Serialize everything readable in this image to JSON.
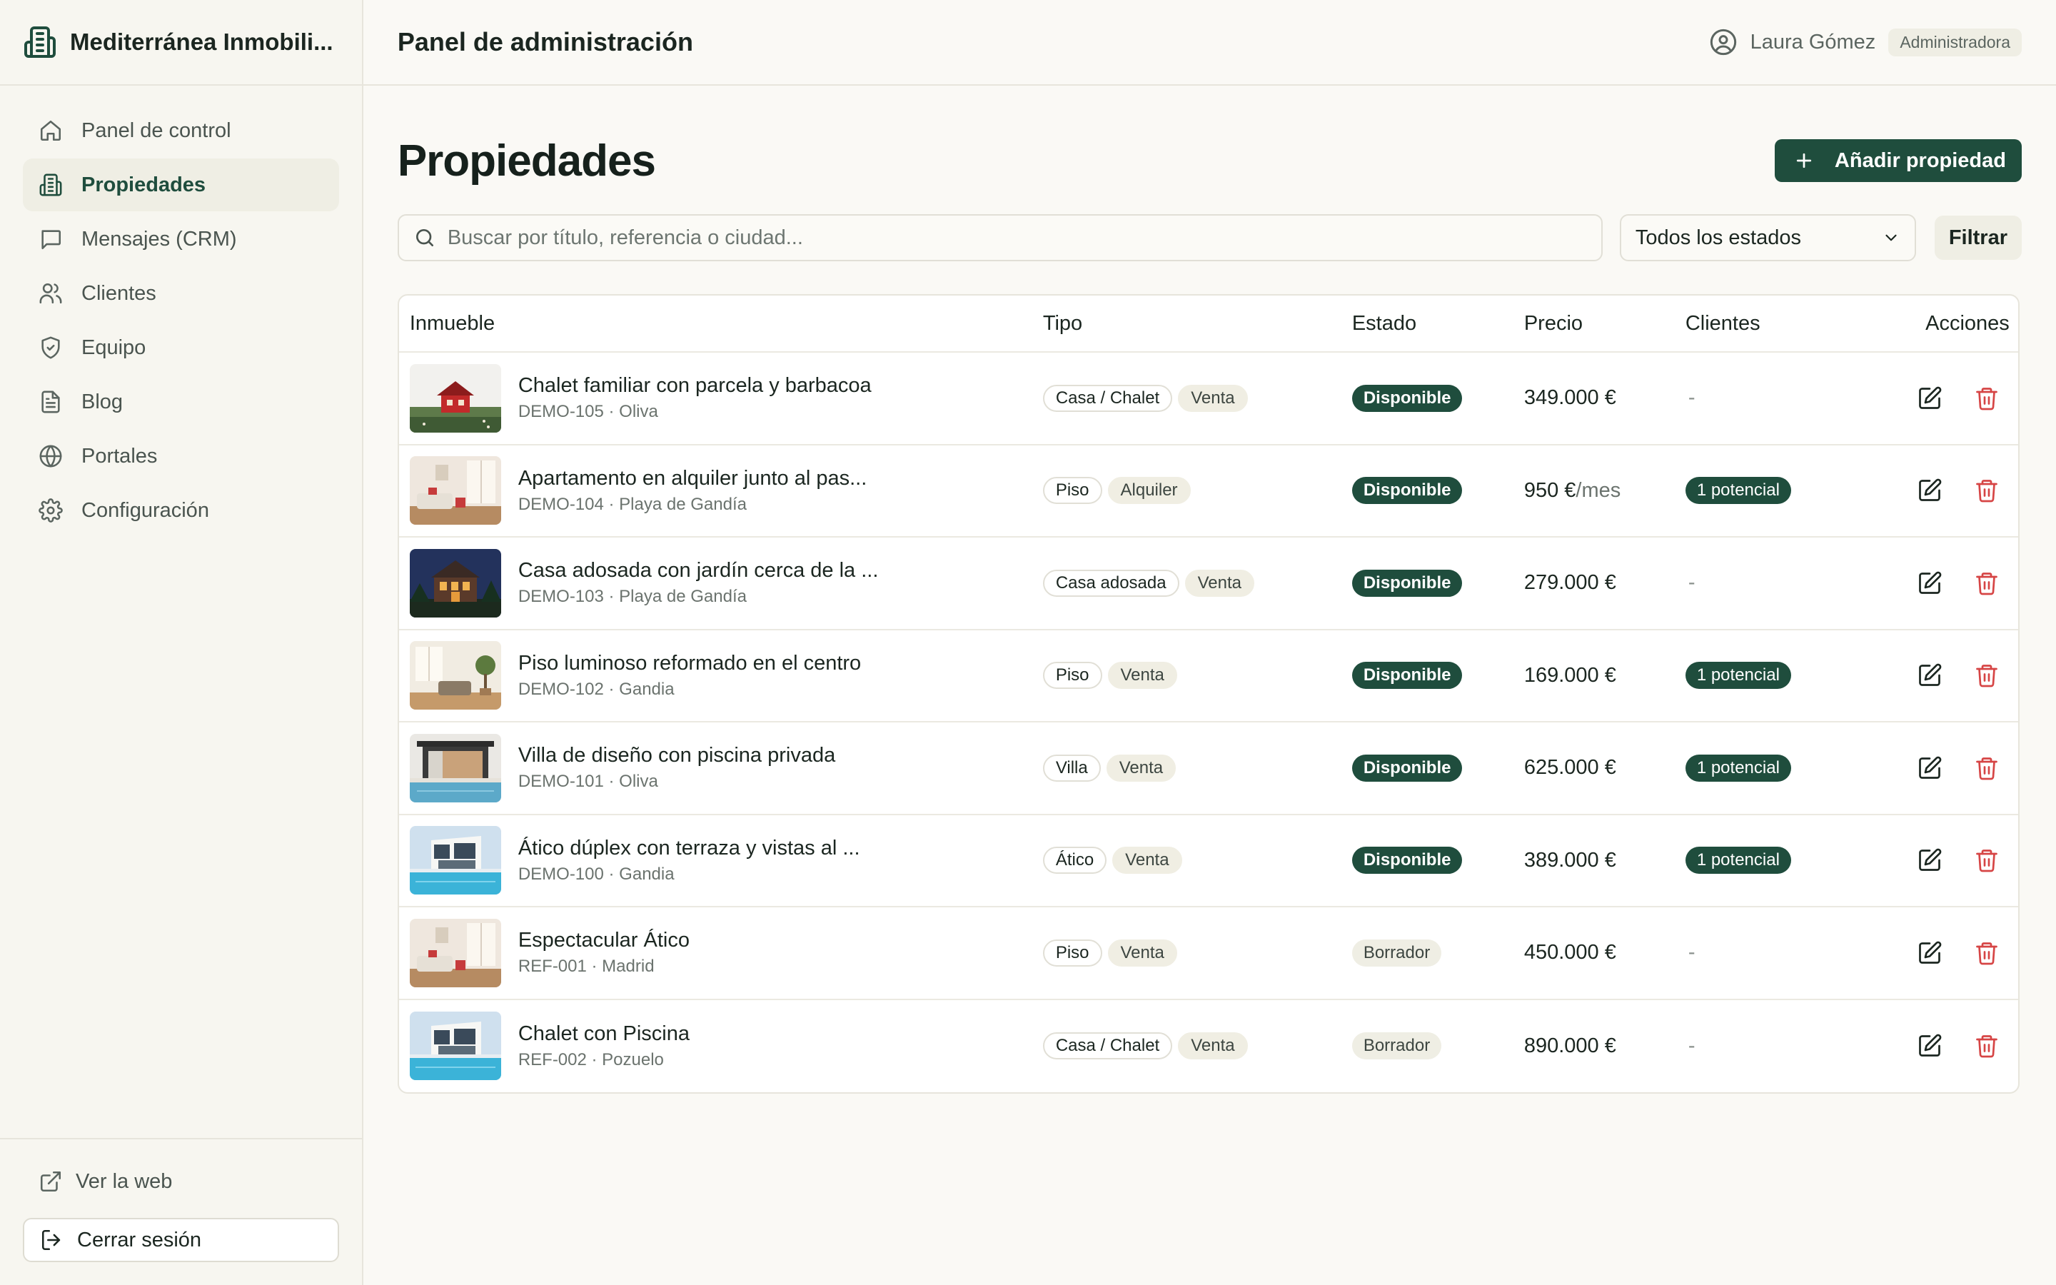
{
  "brand": {
    "name": "Mediterránea Inmobili..."
  },
  "sidebar": {
    "items": [
      {
        "label": "Panel de control",
        "icon": "home-icon"
      },
      {
        "label": "Propiedades",
        "icon": "building-icon",
        "active": true
      },
      {
        "label": "Mensajes (CRM)",
        "icon": "message-icon"
      },
      {
        "label": "Clientes",
        "icon": "users-icon"
      },
      {
        "label": "Equipo",
        "icon": "shield-icon"
      },
      {
        "label": "Blog",
        "icon": "file-icon"
      },
      {
        "label": "Portales",
        "icon": "globe-icon"
      },
      {
        "label": "Configuración",
        "icon": "gear-icon"
      }
    ],
    "footer": {
      "view_site": "Ver la web",
      "logout": "Cerrar sesión"
    }
  },
  "topbar": {
    "title": "Panel de administración",
    "user_name": "Laura Gómez",
    "user_role": "Administradora"
  },
  "page": {
    "title": "Propiedades",
    "add_button": "Añadir propiedad",
    "search_placeholder": "Buscar por título, referencia o ciudad...",
    "status_filter": "Todos los estados",
    "filter_button": "Filtrar"
  },
  "table": {
    "columns": [
      "Inmueble",
      "Tipo",
      "Estado",
      "Precio",
      "Clientes",
      "Acciones"
    ],
    "rows": [
      {
        "title": "Chalet familiar con parcela y barbacoa",
        "ref": "DEMO-105 · Oliva",
        "type": "Casa / Chalet",
        "op": "Venta",
        "status": "Disponible",
        "price": "349.000 €",
        "price_unit": "",
        "clients": "-",
        "thumb": "red-house"
      },
      {
        "title": "Apartamento en alquiler junto al pas...",
        "ref": "DEMO-104 · Playa de Gandía",
        "type": "Piso",
        "op": "Alquiler",
        "status": "Disponible",
        "price": "950 €",
        "price_unit": "/mes",
        "clients": "1 potencial",
        "thumb": "living-room"
      },
      {
        "title": "Casa adosada con jardín cerca de la ...",
        "ref": "DEMO-103 · Playa de Gandía",
        "type": "Casa adosada",
        "op": "Venta",
        "status": "Disponible",
        "price": "279.000 €",
        "price_unit": "",
        "clients": "-",
        "thumb": "night-house"
      },
      {
        "title": "Piso luminoso reformado en el centro",
        "ref": "DEMO-102 · Gandia",
        "type": "Piso",
        "op": "Venta",
        "status": "Disponible",
        "price": "169.000 €",
        "price_unit": "",
        "clients": "1 potencial",
        "thumb": "bright-room"
      },
      {
        "title": "Villa de diseño con piscina privada",
        "ref": "DEMO-101 · Oliva",
        "type": "Villa",
        "op": "Venta",
        "status": "Disponible",
        "price": "625.000 €",
        "price_unit": "",
        "clients": "1 potencial",
        "thumb": "pool-villa"
      },
      {
        "title": "Ático dúplex con terraza y vistas al ...",
        "ref": "DEMO-100 · Gandia",
        "type": "Ático",
        "op": "Venta",
        "status": "Disponible",
        "price": "389.000 €",
        "price_unit": "",
        "clients": "1 potencial",
        "thumb": "modern-villa"
      },
      {
        "title": "Espectacular Ático",
        "ref": "REF-001 · Madrid",
        "type": "Piso",
        "op": "Venta",
        "status": "Borrador",
        "price": "450.000 €",
        "price_unit": "",
        "clients": "-",
        "thumb": "living-room"
      },
      {
        "title": "Chalet con Piscina",
        "ref": "REF-002 · Pozuelo",
        "type": "Casa / Chalet",
        "op": "Venta",
        "status": "Borrador",
        "price": "890.000 €",
        "price_unit": "",
        "clients": "-",
        "thumb": "modern-villa"
      }
    ]
  },
  "colors": {
    "accent": "#1f4d3d",
    "danger": "#d64545",
    "background": "#faf9f5"
  }
}
